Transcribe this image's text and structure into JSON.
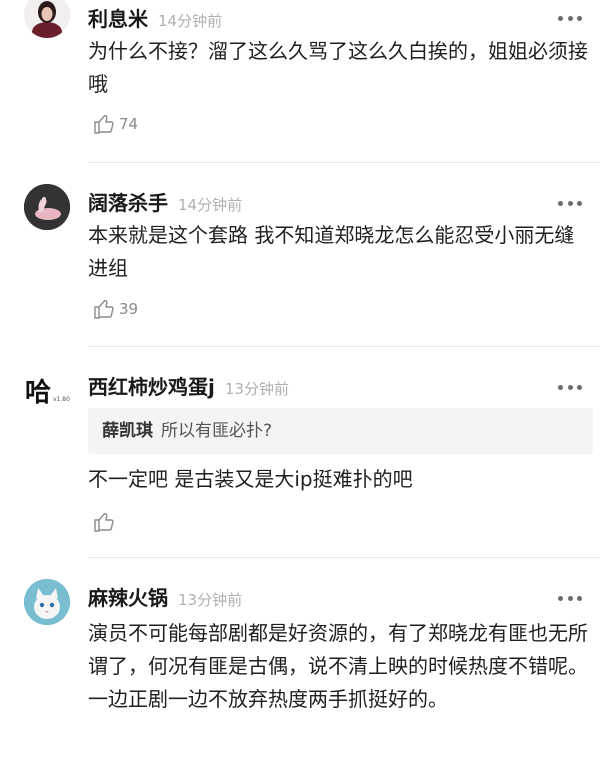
{
  "comments": [
    {
      "username": "利息米",
      "time": "14分钟前",
      "text": "为什么不接？溜了这么久骂了这么久白挨的，姐姐必须接哦",
      "likes": "74"
    },
    {
      "username": "阔落杀手",
      "time": "14分钟前",
      "text": "本来就是这个套路 我不知道郑晓龙怎么能忍受小丽无缝进组",
      "likes": "39"
    },
    {
      "username": "西红柿炒鸡蛋j",
      "time": "13分钟前",
      "avatar_text": "哈",
      "avatar_badge": "v1.80",
      "quote_author": "薛凯琪",
      "quote_text": "所以有匪必扑?",
      "text": "不一定吧 是古装又是大ip挺难扑的吧",
      "likes": ""
    },
    {
      "username": "麻辣火锅",
      "time": "13分钟前",
      "text": "演员不可能每部剧都是好资源的，有了郑晓龙有匪也无所谓了，何况有匪是古偶，说不清上映的时候热度不错呢。一边正剧一边不放弃热度两手抓挺好的。"
    }
  ],
  "colors": {
    "username": "#1a1a1a",
    "time": "#b0b0b0",
    "like": "#8a8a8a",
    "quote_bg": "#f4f4f4",
    "divider": "#e6e6e6"
  }
}
